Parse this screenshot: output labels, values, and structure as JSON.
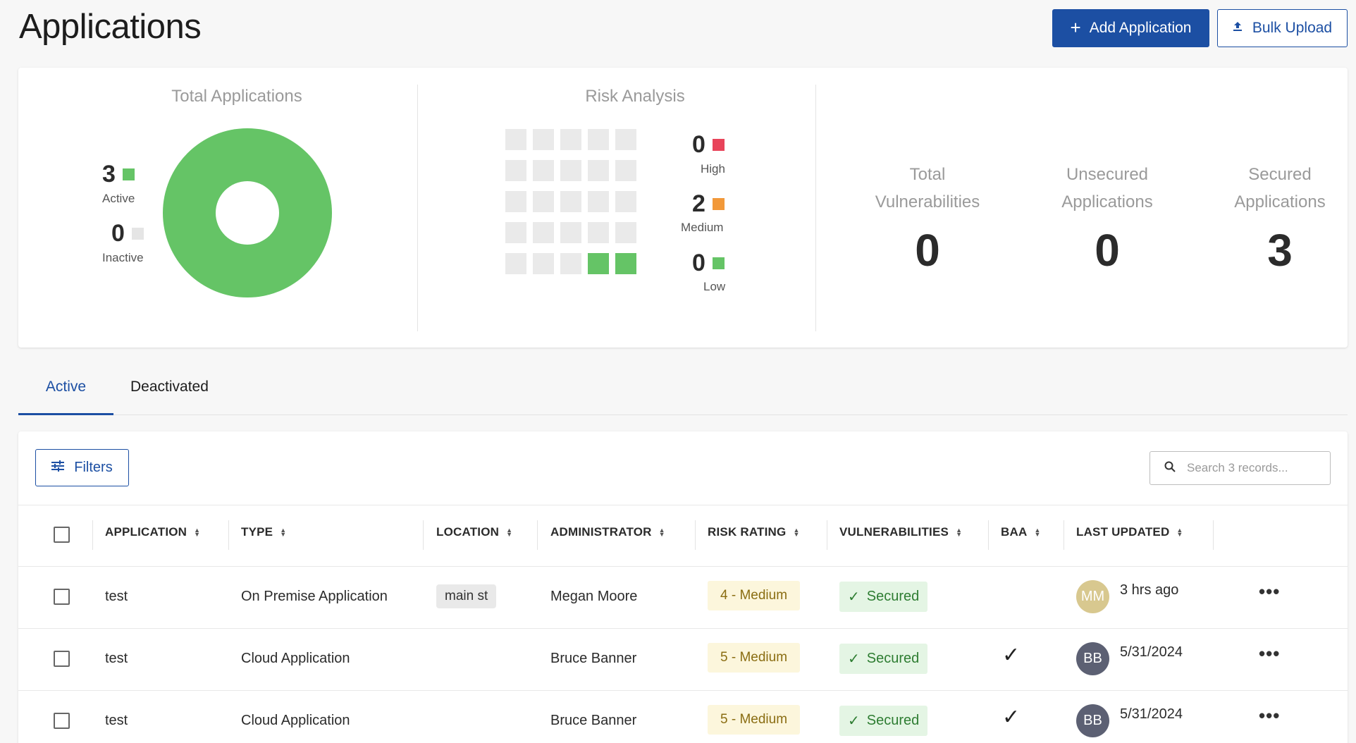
{
  "header": {
    "title": "Applications",
    "add_label": "Add Application",
    "bulk_label": "Bulk Upload"
  },
  "total_applications": {
    "title": "Total Applications",
    "active_count": "3",
    "active_label": "Active",
    "inactive_count": "0",
    "inactive_label": "Inactive",
    "active_color": "#65c466",
    "inactive_color": "#e5e5e5"
  },
  "risk_analysis": {
    "title": "Risk Analysis",
    "high_count": "0",
    "high_label": "High",
    "high_color": "#e8445a",
    "medium_count": "2",
    "medium_label": "Medium",
    "medium_color": "#f2993a",
    "low_count": "0",
    "low_label": "Low",
    "low_color": "#65c466"
  },
  "stats": {
    "total_vuln_line1": "Total",
    "total_vuln_line2": "Vulnerabilities",
    "total_vuln_value": "0",
    "unsecured_line1": "Unsecured",
    "unsecured_line2": "Applications",
    "unsecured_value": "0",
    "secured_line1": "Secured",
    "secured_line2": "Applications",
    "secured_value": "3"
  },
  "tabs": {
    "active": "Active",
    "deactivated": "Deactivated"
  },
  "table": {
    "filters_label": "Filters",
    "search_placeholder": "Search 3 records...",
    "columns": {
      "application": "APPLICATION",
      "type": "TYPE",
      "location": "LOCATION",
      "administrator": "ADMINISTRATOR",
      "risk_rating": "RISK RATING",
      "vulnerabilities": "VULNERABILITIES",
      "baa": "BAA",
      "last_updated": "LAST UPDATED"
    },
    "rows": [
      {
        "application": "test",
        "type": "On Premise Application",
        "location": "main st",
        "administrator": "Megan Moore",
        "risk": "4 - Medium",
        "vulnerabilities": "Secured",
        "baa": "",
        "avatar": "MM",
        "avatar_color": "#d8c88f",
        "last_updated": "3 hrs ago"
      },
      {
        "application": "test",
        "type": "Cloud Application",
        "location": "",
        "administrator": "Bruce Banner",
        "risk": "5 - Medium",
        "vulnerabilities": "Secured",
        "baa": "✓",
        "avatar": "BB",
        "avatar_color": "#5c6073",
        "last_updated": "5/31/2024"
      },
      {
        "application": "test",
        "type": "Cloud Application",
        "location": "",
        "administrator": "Bruce Banner",
        "risk": "5 - Medium",
        "vulnerabilities": "Secured",
        "baa": "✓",
        "avatar": "BB",
        "avatar_color": "#5c6073",
        "last_updated": "5/31/2024"
      }
    ]
  }
}
